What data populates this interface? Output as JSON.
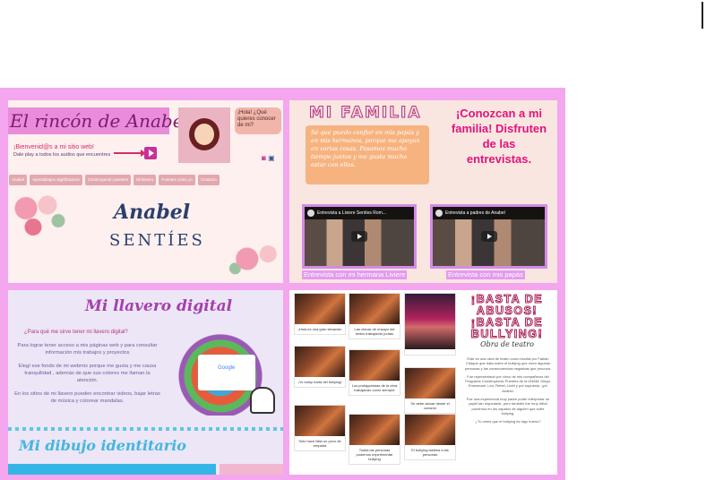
{
  "panel1": {
    "title": "El rincón de Anabel",
    "welcome": "¡Bienvenid@s a mi sitio web!",
    "welcome_sub": "Dale play a todos los audios que encuentres",
    "bubble": "¡Hola! ¿Qué quieres conocer de mi?",
    "nav": [
      "Anabel",
      "Aprendizajes significativos",
      "Construyendo puentes",
      "Mi llavero",
      "Fuentes como yo",
      "Contacto"
    ],
    "name": "Anabel",
    "surname": "SENTÍES",
    "icons": [
      "instagram-icon",
      "facebook-icon"
    ]
  },
  "panel2": {
    "title": "MI FAMILIA",
    "text": "Sé que puedo confiar en mis papás y en mis hermanos, porque me apoyan en varias cosas. Pasamos mucho tiempo juntos y me gusta mucho estar con ellos.",
    "heading": "¡Conozcan a mi familia! Disfruten de las entrevistas.",
    "video1_title": "Entrevista a Liviere Sentíes Rom...",
    "video2_title": "Entrevista a padres de Anabel",
    "video1_caption": "Entrevista con mi hermana Liviere",
    "video2_caption": "Entrevista con mis papás"
  },
  "panel3": {
    "title": "Mi llavero digital",
    "question": "¿Para qué me sirve tener mi llavero digital?",
    "paragraphs": [
      "Para lograr tener acceso a mis páginas web y para consultar información mis trabajos y proyectos",
      "Elegí ese fondo de mi webmix porque me gusta y me causa tranquilidad , además de que sus colores me llaman la atención.",
      "En los sitios de mi llavero pueden encontrar videos, bajar letras de música y colorear mandalas."
    ],
    "card_label": "Google",
    "subtitle": "Mi dibujo identitario"
  },
  "panel4": {
    "tiles": [
      {
        "caption": "¡Hola es una gran situación"
      },
      {
        "caption": "Las chicas de ensayo del teatro trabajando juntas"
      },
      {
        "caption": ""
      },
      {
        "caption": "¡Yo estoy harta del bullying!"
      },
      {
        "caption": "Los protagonistas de la obra trabajando como siempre"
      },
      {
        "caption": "Se debe actuar desde el corazón"
      },
      {
        "caption": "Sólo hace falta un poco de empatía"
      },
      {
        "caption": "Todas las personas podemos experimentar bullying"
      },
      {
        "caption": "El bullying lastima a las personas"
      }
    ],
    "title_line1": "¡BASTA DE",
    "title_line2": "ABUSOS!",
    "title_line3": "¡BASTA DE",
    "title_line4": "BULLYING!",
    "subtitle": "Obra de teatro",
    "body": [
      "Este es una obra de teatro como escrita por Fabián Chaque que trata sobre el bullying que viven algunas personas y las consecuencias negativas que provoca.",
      "Fue representado por cinco de mis compañeros del Programa Construyendo Puentes de la UNAM: Diego, Emmanuel, Leo, Rebel, Lirett y por supuesto, ¡yo! Anabel.",
      "Fue una experiencia muy padre poder interpretar un papel tan importante, pero también fue muy difícil ponernos en los zapatos de alguien que sufre bullying.",
      "¿Tú crees que el bullying es algo bueno?"
    ]
  },
  "colors": {
    "frame": "#f4a6ef",
    "accent": "#e2137c"
  }
}
